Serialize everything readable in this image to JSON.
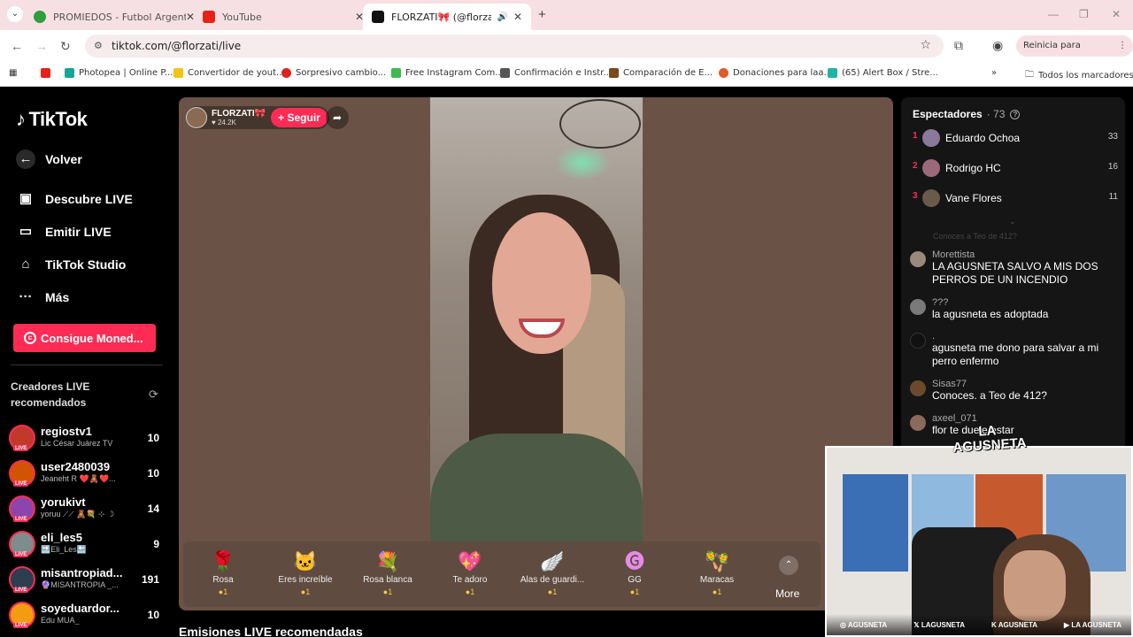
{
  "browser": {
    "tabs": [
      {
        "title": "PROMIEDOS - Futbol Argentino",
        "color": "#2e9e3f"
      },
      {
        "title": "YouTube",
        "color": "#e62117"
      },
      {
        "title": "FLORZATI🎀 (@florzati) está",
        "color": "#111111"
      }
    ],
    "url": "tiktok.com/@florzati/live",
    "relaunch": "Reinicia para actualizar",
    "bookmarks": [
      {
        "label": "Photopea | Online P...",
        "color": "#18a497"
      },
      {
        "label": "Convertidor de yout...",
        "color": "#f0c419"
      },
      {
        "label": "Sorpresivo cambio...",
        "color": "#d22"
      },
      {
        "label": "Free Instagram Com...",
        "color": "#3fb950"
      },
      {
        "label": "Confirmación e Instr...",
        "color": "#555555"
      },
      {
        "label": "Comparación de E...",
        "color": "#7a4a1a"
      },
      {
        "label": "Donaciones para laa...",
        "color": "#e05a2b"
      },
      {
        "label": "(65) Alert Box / Stre...",
        "color": "#1fb5a0"
      }
    ],
    "all_bookmarks": "Todos los marcadores"
  },
  "sidebar": {
    "logo": "TikTok",
    "back": "Volver",
    "nav": [
      {
        "label": "Descubre LIVE",
        "icon": "calendar-icon"
      },
      {
        "label": "Emitir LIVE",
        "icon": "video-camera-icon"
      },
      {
        "label": "TikTok Studio",
        "icon": "home-icon"
      },
      {
        "label": "Más",
        "icon": "more-icon"
      }
    ],
    "coins_button": "Consigue Moned...",
    "reco_title": "Creadores LIVE recomendados",
    "live_badge": "LIVE",
    "creators": [
      {
        "name": "regiostv1",
        "sub": "Lic César Juárez TV",
        "count": "10",
        "color": "#c0392b"
      },
      {
        "name": "user2480039",
        "sub": "Jeaneht R ❤️🧸❤️...",
        "count": "10",
        "color": "#d35400"
      },
      {
        "name": "yorukivt",
        "sub": "yoruu ⟋⟋ 🧸💐 ⊹ ☽",
        "count": "14",
        "color": "#8e44ad"
      },
      {
        "name": "eli_les5",
        "sub": "🔜Eli_Les🔙",
        "count": "9",
        "color": "#7f8c8d"
      },
      {
        "name": "misantropiad...",
        "sub": "🔮MISANTROPIA _...",
        "count": "191",
        "color": "#2c3e50"
      },
      {
        "name": "soyeduardor...",
        "sub": "Edu MUA_",
        "count": "10",
        "color": "#f39c12"
      }
    ]
  },
  "video": {
    "host_name": "FLORZATI🎀",
    "host_likes": "♥ 24.2K",
    "follow": "+ Seguir",
    "gifts": [
      {
        "name": "Rosa",
        "icon": "🌹",
        "price": "●1"
      },
      {
        "name": "Eres increíble",
        "icon": "🐱",
        "price": "●1"
      },
      {
        "name": "Rosa blanca",
        "icon": "💐",
        "price": "●1"
      },
      {
        "name": "Te adoro",
        "icon": "💖",
        "price": "●1"
      },
      {
        "name": "Alas de guardi...",
        "icon": "🪽",
        "price": "●1"
      },
      {
        "name": "GG",
        "icon": "🅖",
        "price": "●1"
      },
      {
        "name": "Maracas",
        "icon": "🪇",
        "price": "●1"
      }
    ],
    "more": "More"
  },
  "recommended_streams": "Emisiones LIVE recomendadas",
  "panel": {
    "title": "Espectadores",
    "count": "· 73",
    "viewers": [
      {
        "rank": "1",
        "name": "Eduardo Ochoa",
        "score": "33",
        "color": "#8a7a9a"
      },
      {
        "rank": "2",
        "name": "Rodrigo HC",
        "score": "16",
        "color": "#9a6a7a"
      },
      {
        "rank": "3",
        "name": "Vane Flores",
        "score": "11",
        "color": "#6a5a4a"
      }
    ],
    "faded": "Conoces a Teo de 412?",
    "comments": [
      {
        "user": "Morettista",
        "text": "LA AGUSNETA SALVO A MIS DOS PERROS DE UN INCENDIO",
        "color": "#9a8a7a"
      },
      {
        "user": "???",
        "text": "la agusneta es adoptada",
        "color": "#7a7a7a"
      },
      {
        "user": ".",
        "text": "agusneta me dono para salvar a mi perro enfermo",
        "color": "#111111"
      },
      {
        "user": "Sisas77",
        "text": "Conoces. a Teo de 412?",
        "color": "#6a4a2a"
      },
      {
        "user": "axeel_071",
        "text": "flor te duele estar",
        "color": "#8a6a5a"
      }
    ]
  },
  "webcam": {
    "brand": "LA AGUSNETA",
    "socials": [
      "◎ AGUSNETA",
      "𝕏 LAGUSNETA",
      "K AGUSNETA",
      "▶ LA AGUSNETA"
    ]
  }
}
